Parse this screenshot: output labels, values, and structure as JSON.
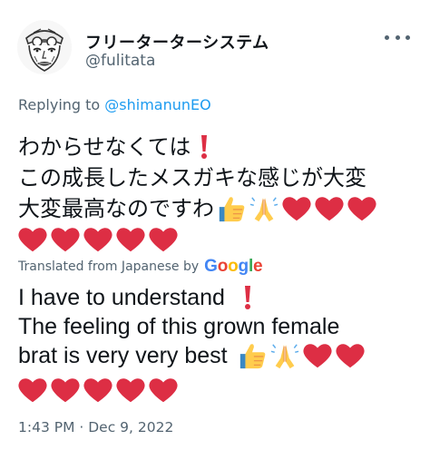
{
  "author": {
    "display_name": "フリーターターシステム",
    "handle": "@fulitata"
  },
  "reply": {
    "prefix": "Replying to",
    "mention": "@shimanunEO"
  },
  "tweet": {
    "line1": "わからせなくては",
    "line2": "この成長したメスガキな感じが大変",
    "line3": "大変最高なのですわ",
    "line1_emojis": [
      "exclamation-icon"
    ],
    "line3_emojis": [
      "thumbs-up-icon",
      "folded-hands-icon",
      "heart-icon",
      "heart-icon",
      "heart-icon"
    ],
    "line4_emojis": [
      "heart-icon",
      "heart-icon",
      "heart-icon",
      "heart-icon",
      "heart-icon"
    ]
  },
  "translation": {
    "label": "Translated from Japanese by",
    "provider": "Google",
    "line1": "I have to understand",
    "line2": "The feeling of this grown female",
    "line3": "brat is very very best",
    "line1_emojis": [
      "exclamation-icon"
    ],
    "line3_emojis": [
      "thumbs-up-icon",
      "folded-hands-icon",
      "heart-icon",
      "heart-icon"
    ],
    "line4_emojis": [
      "heart-icon",
      "heart-icon",
      "heart-icon",
      "heart-icon",
      "heart-icon"
    ]
  },
  "meta": {
    "timestamp": "1:43 PM · Dec 9, 2022"
  },
  "colors": {
    "text": "#0f1419",
    "secondary": "#536471",
    "link": "#1d9bf0",
    "heart": "#dd2e44",
    "google_blue": "#4285f4",
    "google_red": "#ea4335",
    "google_yellow": "#fbbc05",
    "google_green": "#34a853"
  }
}
